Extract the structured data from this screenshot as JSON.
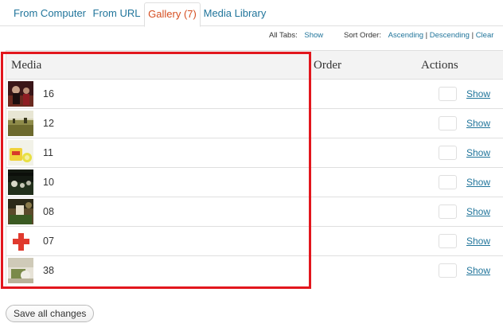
{
  "tabs": [
    {
      "label": "From Computer",
      "active": false
    },
    {
      "label": "From URL",
      "active": false
    },
    {
      "label": "Gallery (7)",
      "active": true
    },
    {
      "label": "Media Library",
      "active": false
    }
  ],
  "options": {
    "all_tabs_label": "All Tabs:",
    "all_tabs_link": "Show",
    "sort_order_label": "Sort Order:",
    "ascending": "Ascending",
    "descending": "Descending",
    "clear": "Clear",
    "separator": "|"
  },
  "table": {
    "headers": {
      "media": "Media",
      "order": "Order",
      "actions": "Actions"
    },
    "rows": [
      {
        "title": "16",
        "thumb": "thumb-16",
        "action": "Show",
        "order": ""
      },
      {
        "title": "12",
        "thumb": "thumb-12",
        "action": "Show",
        "order": ""
      },
      {
        "title": "11",
        "thumb": "thumb-11",
        "action": "Show",
        "order": ""
      },
      {
        "title": "10",
        "thumb": "thumb-10",
        "action": "Show",
        "order": ""
      },
      {
        "title": "08",
        "thumb": "thumb-08",
        "action": "Show",
        "order": ""
      },
      {
        "title": "07",
        "thumb": "thumb-07",
        "action": "Show",
        "order": ""
      },
      {
        "title": "38",
        "thumb": "thumb-38",
        "action": "Show",
        "order": ""
      }
    ]
  },
  "save_button": "Save all changes",
  "colors": {
    "link": "#21759b",
    "active_tab": "#d54e21",
    "highlight": "#e2161d",
    "border": "#dfdfdf",
    "header_bg": "#f3f3f3"
  }
}
